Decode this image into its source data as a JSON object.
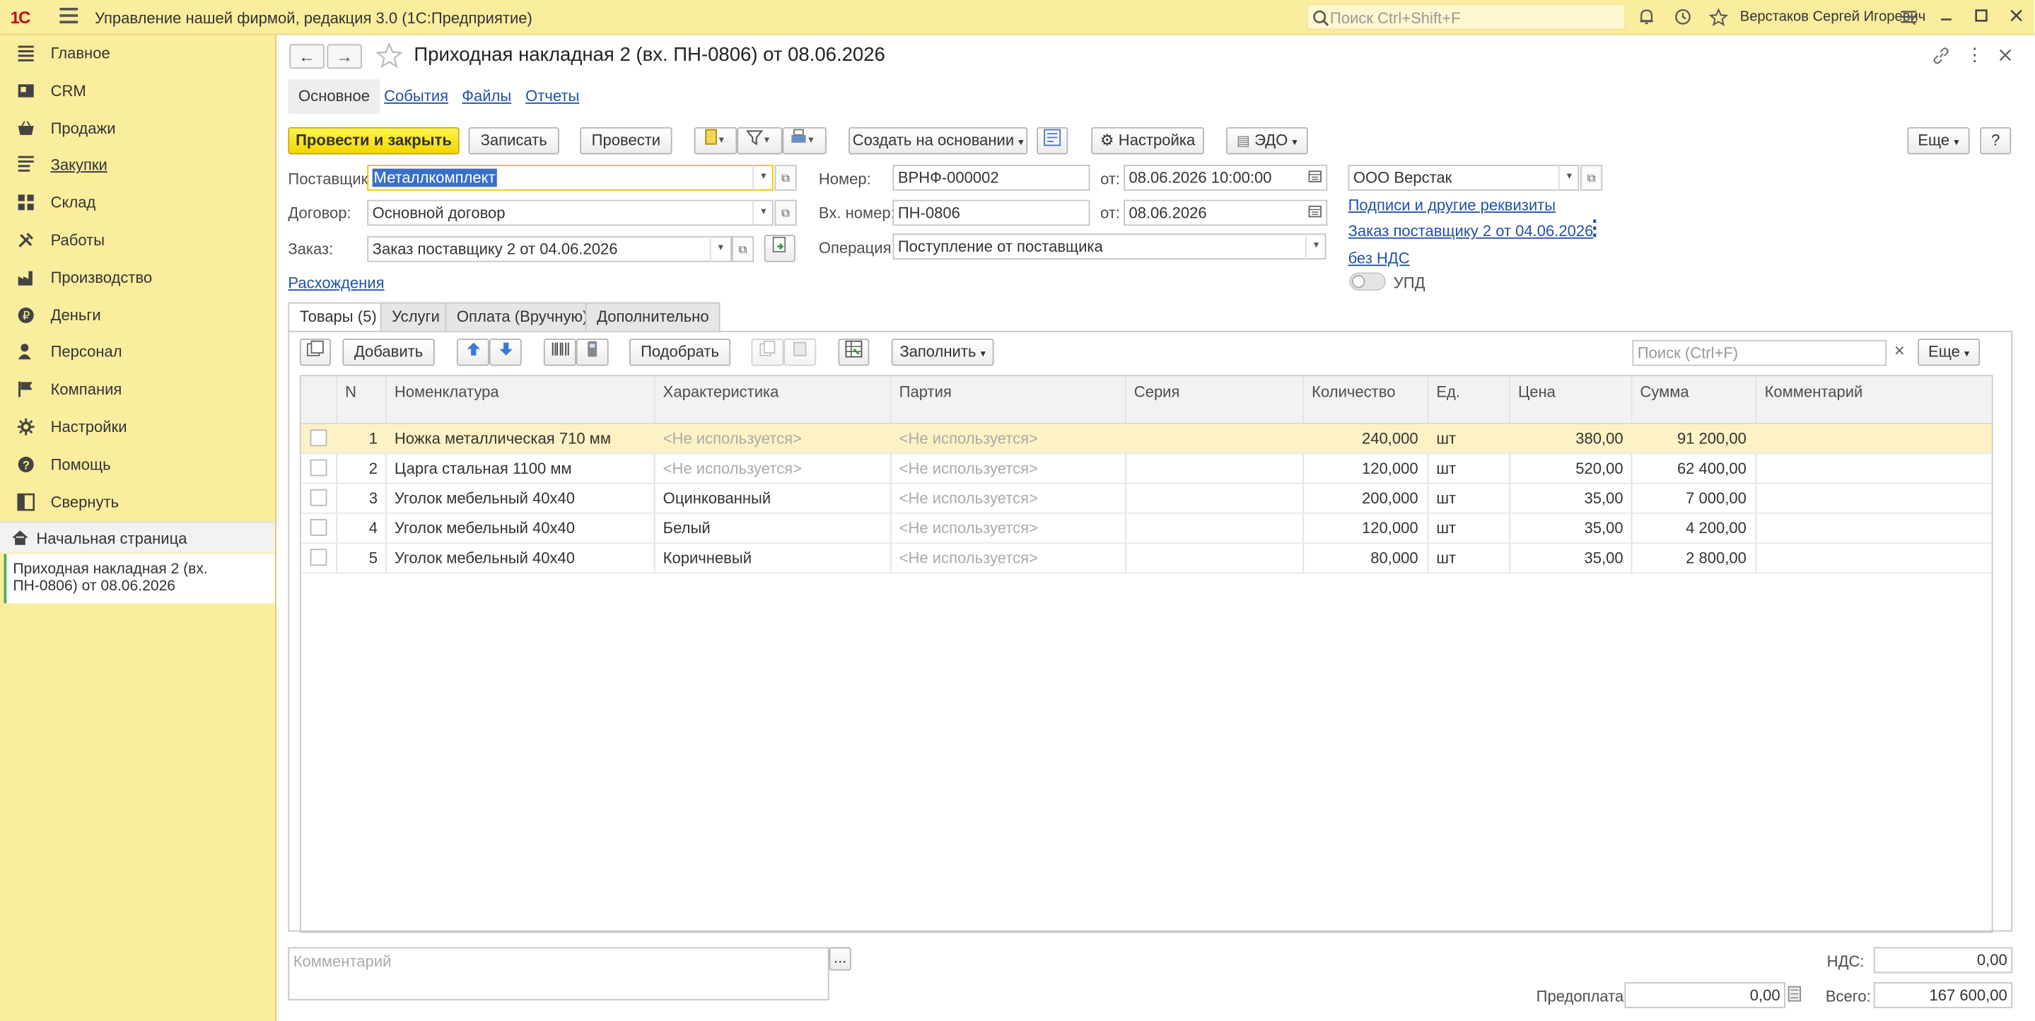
{
  "titlebar": {
    "logo": "1С",
    "app_title": "Управление нашей фирмой, редакция 3.0  (1С:Предприятие)",
    "search_placeholder": "Поиск Ctrl+Shift+F",
    "user": "Верстаков Сергей Игоревич"
  },
  "sidebar": {
    "items": [
      {
        "label": "Главное",
        "icon": "list-icon"
      },
      {
        "label": "CRM",
        "icon": "crm-icon"
      },
      {
        "label": "Продажи",
        "icon": "basket-icon"
      },
      {
        "label": "Закупки",
        "icon": "purchases-icon"
      },
      {
        "label": "Склад",
        "icon": "warehouse-icon"
      },
      {
        "label": "Работы",
        "icon": "tools-icon"
      },
      {
        "label": "Производство",
        "icon": "factory-icon"
      },
      {
        "label": "Деньги",
        "icon": "money-icon"
      },
      {
        "label": "Персонал",
        "icon": "person-icon"
      },
      {
        "label": "Компания",
        "icon": "flag-icon"
      },
      {
        "label": "Настройки",
        "icon": "gear-icon"
      },
      {
        "label": "Помощь",
        "icon": "help-icon"
      },
      {
        "label": "Свернуть",
        "icon": "collapse-icon"
      }
    ],
    "home": "Начальная страница",
    "open_doc": "Приходная накладная 2 (вх. ПН-0806) от 08.06.2026"
  },
  "document": {
    "title": "Приходная накладная 2 (вх. ПН-0806) от 08.06.2026",
    "tabs": [
      "Основное",
      "События",
      "Файлы",
      "Отчеты"
    ],
    "toolbar": {
      "post_close": "Провести и закрыть",
      "save": "Записать",
      "post": "Провести",
      "create_based": "Создать на основании",
      "settings": "Настройка",
      "edo": "ЭДО",
      "more": "Еще",
      "help": "?"
    },
    "fields": {
      "supplier_label": "Поставщик:",
      "supplier": "Металлкомплект",
      "contract_label": "Договор:",
      "contract": "Основной договор",
      "order_label": "Заказ:",
      "order": "Заказ поставщику 2 от 04.06.2026",
      "discrepancies": "Расхождения",
      "number_label": "Номер:",
      "number": "ВРНФ-000002",
      "from_label": "от:",
      "date": "08.06.2026 10:00:00",
      "in_number_label": "Вх. номер:",
      "in_number": "ПН-0806",
      "in_date": "08.06.2026",
      "operation_label": "Операция:",
      "operation": "Поступление от поставщика",
      "company": "ООО Верстак",
      "signatures_link": "Подписи и другие реквизиты",
      "order_link": "Заказ поставщику 2 от 04.06.2026",
      "vat_link": "без НДС",
      "upd_label": "УПД"
    },
    "inner_tabs": [
      "Товары (5)",
      "Услуги",
      "Оплата (Вручную)",
      "Дополнительно"
    ],
    "goods_toolbar": {
      "add": "Добавить",
      "pick": "Подобрать",
      "fill": "Заполнить",
      "search_placeholder": "Поиск (Ctrl+F)",
      "more": "Еще"
    },
    "columns": [
      "N",
      "Номенклатура",
      "Характеристика",
      "Партия",
      "Серия",
      "Количество",
      "Ед.",
      "Цена",
      "Сумма",
      "Комментарий"
    ],
    "rows": [
      {
        "n": "1",
        "item": "Ножка металлическая 710 мм",
        "char": "<Не используется>",
        "batch": "<Не используется>",
        "series": "",
        "qty": "240,000",
        "unit": "шт",
        "price": "380,00",
        "sum": "91 200,00",
        "comment": ""
      },
      {
        "n": "2",
        "item": "Царга стальная 1100 мм",
        "char": "<Не используется>",
        "batch": "<Не используется>",
        "series": "",
        "qty": "120,000",
        "unit": "шт",
        "price": "520,00",
        "sum": "62 400,00",
        "comment": ""
      },
      {
        "n": "3",
        "item": "Уголок мебельный 40х40",
        "char": "Оцинкованный",
        "batch": "<Не используется>",
        "series": "",
        "qty": "200,000",
        "unit": "шт",
        "price": "35,00",
        "sum": "7 000,00",
        "comment": ""
      },
      {
        "n": "4",
        "item": "Уголок мебельный 40х40",
        "char": "Белый",
        "batch": "<Не используется>",
        "series": "",
        "qty": "120,000",
        "unit": "шт",
        "price": "35,00",
        "sum": "4 200,00",
        "comment": ""
      },
      {
        "n": "5",
        "item": "Уголок мебельный 40х40",
        "char": "Коричневый",
        "batch": "<Не используется>",
        "series": "",
        "qty": "80,000",
        "unit": "шт",
        "price": "35,00",
        "sum": "2 800,00",
        "comment": ""
      }
    ],
    "footer": {
      "comment_placeholder": "Комментарий",
      "vat_label": "НДС:",
      "vat": "0,00",
      "prepay_label": "Предоплата:",
      "prepay": "0,00",
      "total_label": "Всего:",
      "total": "167 600,00"
    }
  },
  "colors": {
    "accent": "#fbed9e",
    "primary_button": "#f2d600",
    "link": "#2152a3"
  }
}
